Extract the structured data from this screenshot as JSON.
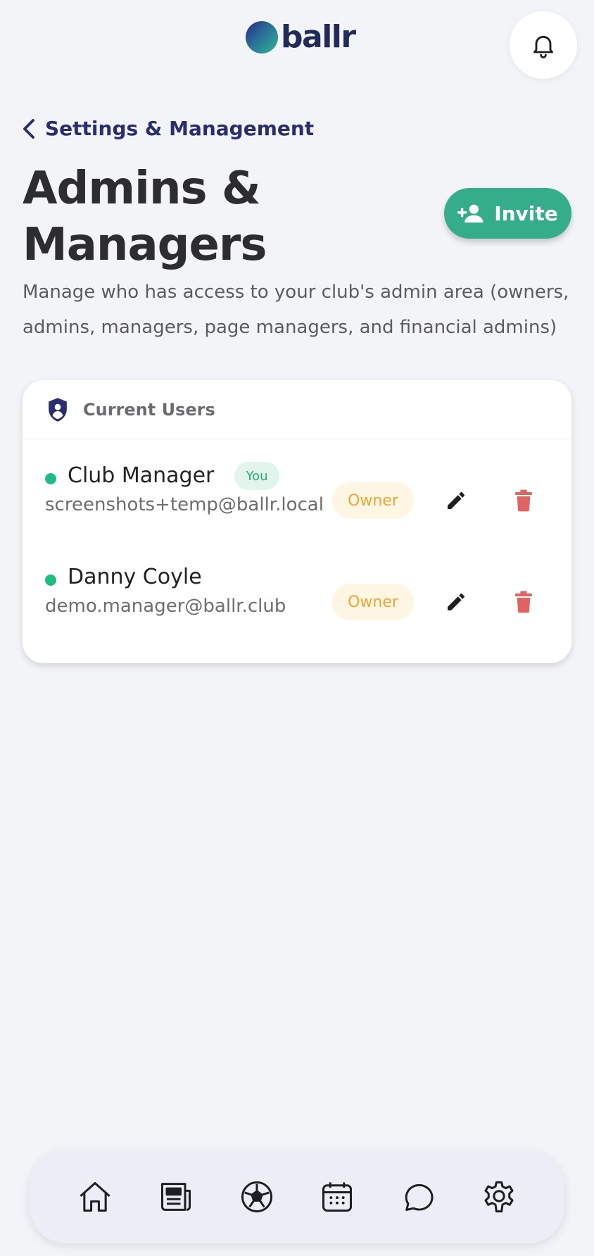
{
  "header": {
    "brand": "ballr",
    "notifications_icon": "bell-icon"
  },
  "breadcrumb": {
    "back_label": "Settings & Management"
  },
  "page": {
    "title": "Admins & Managers",
    "description": "Manage who has access to your club's admin area (owners, admins, managers, page managers, and financial admins)",
    "invite_label": "Invite"
  },
  "users_card": {
    "title": "Current Users",
    "users": [
      {
        "name": "Club Manager",
        "badge": "You",
        "email": "screenshots+temp@ballr.local",
        "role": "Owner"
      },
      {
        "name": "Danny Coyle",
        "email": "demo.manager@ballr.club",
        "role": "Owner"
      }
    ]
  },
  "bottom_nav": {
    "items": [
      "home-icon",
      "news-icon",
      "football-icon",
      "calendar-icon",
      "chat-icon",
      "settings-icon"
    ]
  },
  "colors": {
    "accent": "#36ad8a",
    "brand_navy": "#2b2e6e",
    "online": "#22bb84",
    "delete": "#e06464",
    "owner_text": "#e7a83a"
  }
}
